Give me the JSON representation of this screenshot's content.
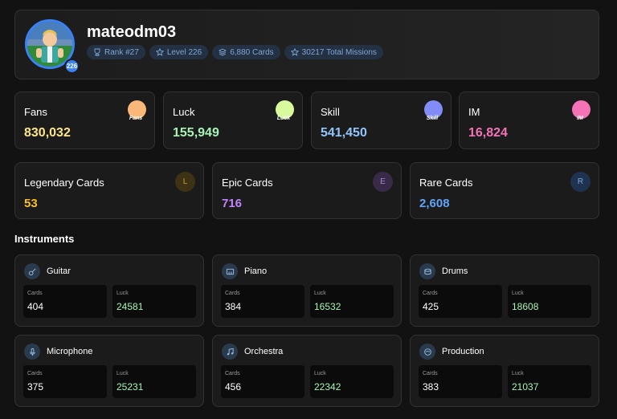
{
  "profile": {
    "username": "mateodm03",
    "level_badge": "226",
    "chips": [
      {
        "icon": "trophy-icon",
        "text": "Rank #27"
      },
      {
        "icon": "star-icon",
        "text": "Level 226"
      },
      {
        "icon": "layers-icon",
        "text": "6,880 Cards"
      },
      {
        "icon": "star-icon",
        "text": "30217 Total Missions"
      }
    ]
  },
  "stats": [
    {
      "label": "Fans",
      "value": "830,032",
      "color": "#fde68a",
      "icon": "fans-icon",
      "icon_text": "Fans",
      "icon_color": "#f9b87a"
    },
    {
      "label": "Luck",
      "value": "155,949",
      "color": "#a7f3b8",
      "icon": "luck-clover-icon",
      "icon_text": "Luck",
      "icon_color": "#d9f99d"
    },
    {
      "label": "Skill",
      "value": "541,450",
      "color": "#93c5fd",
      "icon": "skill-icon",
      "icon_text": "Skill",
      "icon_color": "#818cf8"
    },
    {
      "label": "IM",
      "value": "16,824",
      "color": "#f472b6",
      "icon": "im-icon",
      "icon_text": "IM",
      "icon_color": "#f472b6"
    }
  ],
  "rarity": [
    {
      "label": "Legendary Cards",
      "value": "53",
      "letter": "L",
      "color": "#fbbf24",
      "badge_bg": "#3d3213",
      "badge_fg": "#c9a227"
    },
    {
      "label": "Epic Cards",
      "value": "716",
      "letter": "E",
      "color": "#c084fc",
      "badge_bg": "#3a2a4a",
      "badge_fg": "#a78bc4"
    },
    {
      "label": "Rare Cards",
      "value": "2,608",
      "letter": "R",
      "color": "#60a5fa",
      "badge_bg": "#1f3350",
      "badge_fg": "#7fa6d6"
    }
  ],
  "instruments_title": "Instruments",
  "instruments": [
    {
      "name": "Guitar",
      "icon": "guitar-icon",
      "cards_label": "Cards",
      "cards": "404",
      "luck_label": "Luck",
      "luck": "24581"
    },
    {
      "name": "Piano",
      "icon": "piano-icon",
      "cards_label": "Cards",
      "cards": "384",
      "luck_label": "Luck",
      "luck": "16532"
    },
    {
      "name": "Drums",
      "icon": "drum-icon",
      "cards_label": "Cards",
      "cards": "425",
      "luck_label": "Luck",
      "luck": "18608"
    },
    {
      "name": "Microphone",
      "icon": "microphone-icon",
      "cards_label": "Cards",
      "cards": "375",
      "luck_label": "Luck",
      "luck": "25231"
    },
    {
      "name": "Orchestra",
      "icon": "music-note-icon",
      "cards_label": "Cards",
      "cards": "456",
      "luck_label": "Luck",
      "luck": "22342"
    },
    {
      "name": "Production",
      "icon": "disc-icon",
      "cards_label": "Cards",
      "cards": "383",
      "luck_label": "Luck",
      "luck": "21037"
    }
  ],
  "colors": {
    "accent": "#3b82f6",
    "luck_value": "#a7f3b8"
  }
}
